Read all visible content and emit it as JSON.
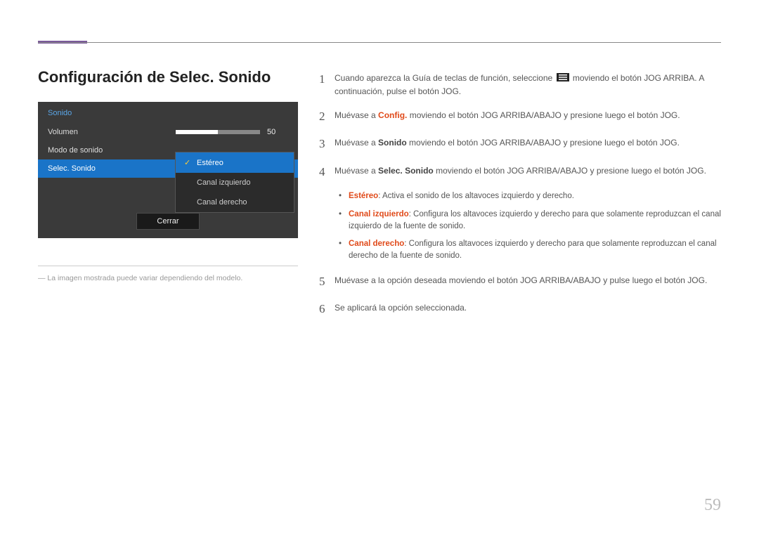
{
  "page": {
    "title": "Configuración de Selec. Sonido",
    "note_prefix": "―",
    "note": "La imagen mostrada puede variar dependiendo del modelo.",
    "number": "59"
  },
  "osd": {
    "menu_title": "Sonido",
    "volume_label": "Volumen",
    "volume_value": "50",
    "volume_percent": 50,
    "mode_label": "Modo de sonido",
    "select_label": "Selec. Sonido",
    "submenu": {
      "stereo": "Estéreo",
      "left": "Canal izquierdo",
      "right": "Canal derecho"
    },
    "close": "Cerrar"
  },
  "steps": {
    "s1_a": "Cuando aparezca la Guía de teclas de función, seleccione ",
    "s1_b": " moviendo el botón JOG ARRIBA. A continuación, pulse el botón JOG.",
    "s2_a": "Muévase a ",
    "s2_hl": "Config.",
    "s2_b": " moviendo el botón JOG ARRIBA/ABAJO y presione luego el botón JOG.",
    "s3_a": "Muévase a ",
    "s3_bd": "Sonido",
    "s3_b": " moviendo el botón JOG ARRIBA/ABAJO y presione luego el botón JOG.",
    "s4_a": "Muévase a ",
    "s4_bd": "Selec. Sonido",
    "s4_b": " moviendo el botón JOG ARRIBA/ABAJO y presione luego el botón JOG.",
    "s5": "Muévase a la opción deseada moviendo el botón JOG ARRIBA/ABAJO y pulse luego el botón JOG.",
    "s6": "Se aplicará la opción seleccionada."
  },
  "bullets": {
    "b1_hl": "Estéreo",
    "b1": ": Activa el sonido de los altavoces izquierdo y derecho.",
    "b2_hl": "Canal izquierdo",
    "b2": ": Configura los altavoces izquierdo y derecho para que solamente reproduzcan el canal izquierdo de la fuente de sonido.",
    "b3_hl": "Canal derecho",
    "b3": ": Configura los altavoces izquierdo y derecho para que solamente reproduzcan el canal derecho de la fuente de sonido."
  },
  "nums": {
    "n1": "1",
    "n2": "2",
    "n3": "3",
    "n4": "4",
    "n5": "5",
    "n6": "6"
  }
}
